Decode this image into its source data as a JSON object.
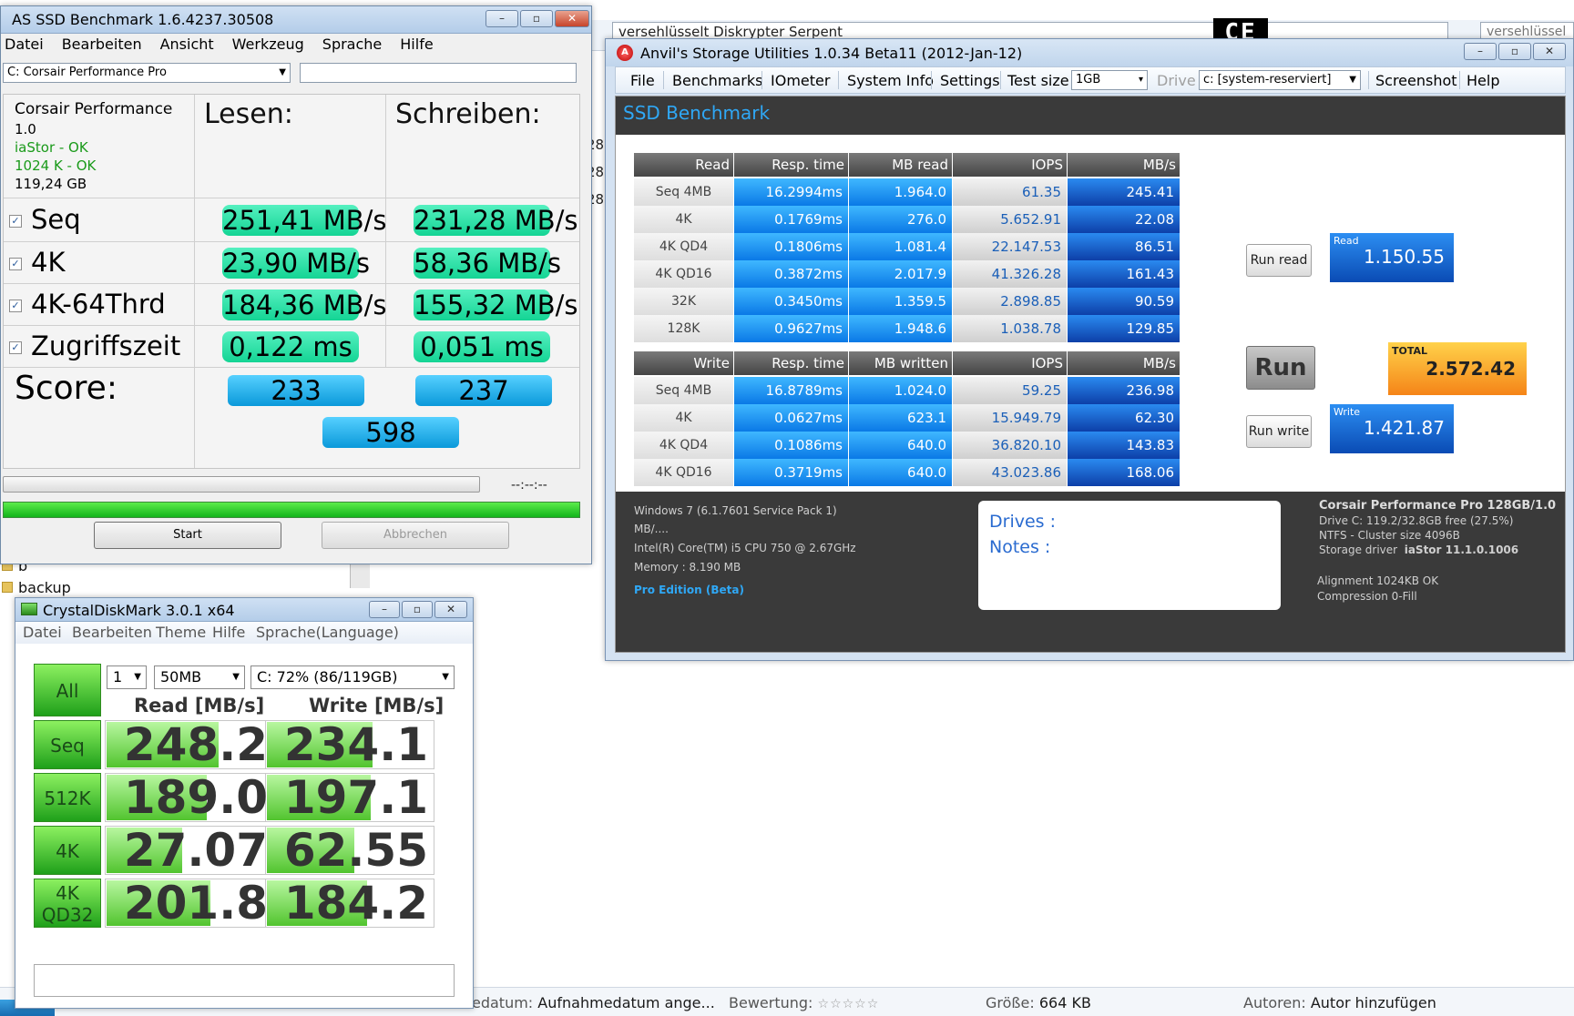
{
  "background": {
    "address_text": "versehlüsselt Diskrypter Serpent",
    "search_text": "versehlüssel",
    "side_numbers": [
      "28",
      "28",
      "28"
    ],
    "folders": [
      "b",
      "backup"
    ],
    "status": {
      "date_label": "edatum:",
      "date_value": "Aufnahmedatum ange...",
      "rating_label": "Bewertung:",
      "rating_stars": "☆☆☆☆☆",
      "size_label": "Größe:",
      "size_value": "664 KB",
      "authors_label": "Autoren:",
      "authors_value": "Autor hinzufügen"
    }
  },
  "asssd": {
    "title": "AS SSD Benchmark 1.6.4237.30508",
    "menu": [
      "Datei",
      "Bearbeiten",
      "Ansicht",
      "Werkzeug",
      "Sprache",
      "Hilfe"
    ],
    "drive_select": "C: Corsair Performance Pro",
    "drive_info": {
      "name": "Corsair Performance",
      "version": "1.0",
      "driver": "iaStor - OK",
      "align": "1024 K - OK",
      "size": "119,24 GB"
    },
    "col_read": "Lesen:",
    "col_write": "Schreiben:",
    "rows": [
      {
        "label": "Seq",
        "read": "251,41 MB/s",
        "write": "231,28 MB/s"
      },
      {
        "label": "4K",
        "read": "23,90 MB/s",
        "write": "58,36 MB/s"
      },
      {
        "label": "4K-64Thrd",
        "read": "184,36 MB/s",
        "write": "155,32 MB/s"
      },
      {
        "label": "Zugriffszeit",
        "read": "0,122 ms",
        "write": "0,051 ms"
      }
    ],
    "score_label": "Score:",
    "score_read": "233",
    "score_write": "237",
    "score_total": "598",
    "progress_time": "--:--:--",
    "progress_percent": 100,
    "start_label": "Start",
    "cancel_label": "Abbrechen",
    "checkmark": "✓"
  },
  "anvil": {
    "title": "Anvil's Storage Utilities 1.0.34 Beta11 (2012-Jan-12)",
    "menu": {
      "file": "File",
      "benchmarks": "Benchmarks",
      "iometer": "IOmeter",
      "sysinfo": "System Info",
      "settings": "Settings",
      "testsize_label": "Test size",
      "testsize_value": "1GB",
      "drive_label": "Drive",
      "drive_value": "c: [system-reserviert]",
      "screenshot": "Screenshot",
      "help": "Help"
    },
    "header": "SSD Benchmark",
    "read_table": {
      "headers": [
        "Read",
        "Resp. time",
        "MB read",
        "IOPS",
        "MB/s"
      ],
      "rows": [
        [
          "Seq 4MB",
          "16.2994ms",
          "1.964.0",
          "61.35",
          "245.41"
        ],
        [
          "4K",
          "0.1769ms",
          "276.0",
          "5.652.91",
          "22.08"
        ],
        [
          "4K QD4",
          "0.1806ms",
          "1.081.4",
          "22.147.53",
          "86.51"
        ],
        [
          "4K QD16",
          "0.3872ms",
          "2.017.9",
          "41.326.28",
          "161.43"
        ],
        [
          "32K",
          "0.3450ms",
          "1.359.5",
          "2.898.85",
          "90.59"
        ],
        [
          "128K",
          "0.9627ms",
          "1.948.6",
          "1.038.78",
          "129.85"
        ]
      ]
    },
    "write_table": {
      "headers": [
        "Write",
        "Resp. time",
        "MB written",
        "IOPS",
        "MB/s"
      ],
      "rows": [
        [
          "Seq 4MB",
          "16.8789ms",
          "1.024.0",
          "59.25",
          "236.98"
        ],
        [
          "4K",
          "0.0627ms",
          "623.1",
          "15.949.79",
          "62.30"
        ],
        [
          "4K QD4",
          "0.1086ms",
          "640.0",
          "36.820.10",
          "143.83"
        ],
        [
          "4K QD16",
          "0.3719ms",
          "640.0",
          "43.023.86",
          "168.06"
        ]
      ]
    },
    "run_read_label": "Run read",
    "run_write_label": "Run write",
    "run_label": "Run",
    "read_score_label": "Read",
    "read_score": "1.150.55",
    "write_score_label": "Write",
    "write_score": "1.421.87",
    "total_label": "TOTAL",
    "total_score": "2.572.42",
    "footer": {
      "os": "Windows 7 (6.1.7601 Service Pack 1)",
      "mbs": "MB/....",
      "cpu": "Intel(R) Core(TM) i5 CPU        750  @ 2.67GHz",
      "memory": "Memory : 8.190 MB",
      "edition": "Pro Edition (Beta)",
      "drives_label": "Drives :",
      "notes_label": "Notes :",
      "drive_model": "Corsair Performance Pro 128GB/1.0",
      "drive_c": "Drive C: 119.2/32.8GB free (27.5%)",
      "ntfs": "NTFS - Cluster size 4096B",
      "storage_driver_label": "Storage driver",
      "storage_driver_value": "iaStor 11.1.0.1006",
      "alignment": "Alignment 1024KB OK",
      "compression": "Compression 0-Fill"
    }
  },
  "ce_logo": "CE",
  "cdm": {
    "title": "CrystalDiskMark 3.0.1 x64",
    "menu": [
      "Datei",
      "Bearbeiten",
      "Theme",
      "Hilfe",
      "Sprache(Language)"
    ],
    "all_label": "All",
    "runs": "1",
    "size": "50MB",
    "drive": "C: 72% (86/119GB)",
    "read_header": "Read [MB/s]",
    "write_header": "Write [MB/s]",
    "rows": [
      {
        "label": "Seq",
        "read": "248.2",
        "write": "234.1",
        "read_fill": 0.67,
        "write_fill": 0.63
      },
      {
        "label": "512K",
        "read": "189.0",
        "write": "197.1",
        "read_fill": 0.6,
        "write_fill": 0.62
      },
      {
        "label": "4K",
        "read": "27.07",
        "write": "62.55",
        "read_fill": 0.45,
        "write_fill": 0.52
      },
      {
        "label": "4K\nQD32",
        "read": "201.8",
        "write": "184.2",
        "read_fill": 0.62,
        "write_fill": 0.6
      }
    ]
  }
}
